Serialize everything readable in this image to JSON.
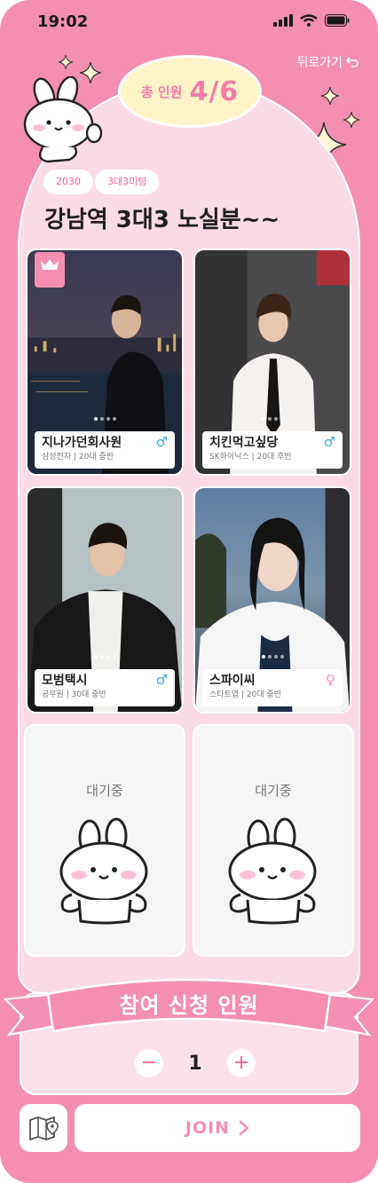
{
  "status_bar": {
    "time": "19:02"
  },
  "header": {
    "back_label": "뒤로가기",
    "count_label": "총 인원",
    "count_value": "4/6"
  },
  "room": {
    "tags": [
      "2030",
      "3대3미팅"
    ],
    "title": "강남역 3대3 노실분~~"
  },
  "members": [
    {
      "nickname": "지나가던회사원",
      "company": "삼성전자",
      "age": "20대 중반",
      "gender_symbol": "♂",
      "host": true
    },
    {
      "nickname": "치킨먹고싶당",
      "company": "SK하이닉스",
      "age": "20대 후반",
      "gender_symbol": "♂",
      "host": false
    },
    {
      "nickname": "모범택시",
      "company": "공무원",
      "age": "30대 중반",
      "gender_symbol": "♂",
      "host": false
    },
    {
      "nickname": "스파이씨",
      "company": "스타트업",
      "age": "20대 중반",
      "gender_symbol": "♀",
      "host": false
    }
  ],
  "waiting": [
    {
      "label": "대기중"
    },
    {
      "label": "대기중"
    }
  ],
  "apply": {
    "banner": "참여 신청 인원",
    "minus": "−",
    "plus": "+",
    "count": "1"
  },
  "footer": {
    "join_label": "JOIN"
  },
  "colors": {
    "background": "#f48fb1",
    "accent": "#f06292",
    "count_pill": "#fff3c8",
    "male": "#3fa9e0",
    "female": "#f48fb1"
  },
  "icons": [
    "signal-icon",
    "wifi-icon",
    "battery-icon",
    "back-arrow-icon",
    "crown-icon",
    "male-icon",
    "female-icon",
    "map-icon",
    "chevron-right-icon",
    "bunny-mascot"
  ]
}
